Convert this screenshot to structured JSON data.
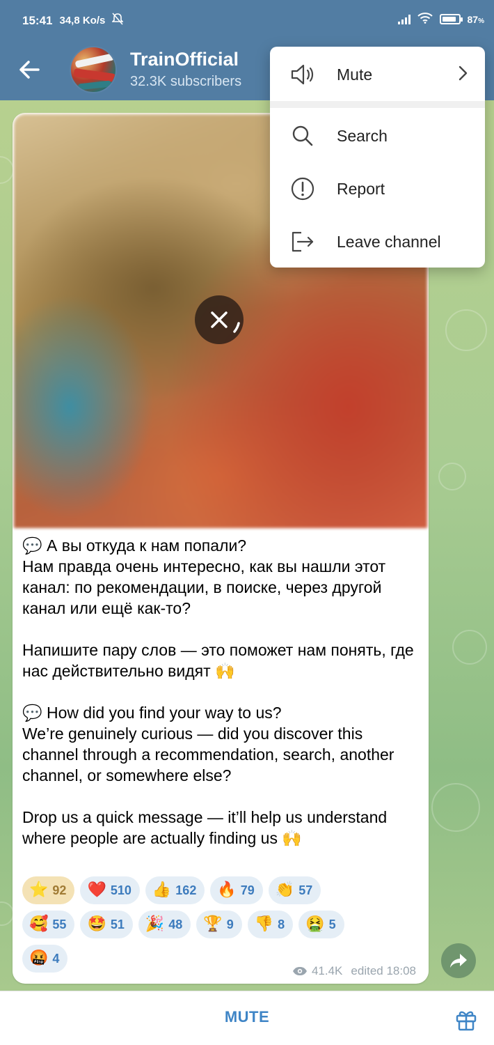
{
  "status_bar": {
    "time": "15:41",
    "speed": "34,8 Ko/s",
    "battery": "87",
    "battery_suffix": "%",
    "battery_level": 0.87
  },
  "header": {
    "channel_name": "TrainOfficial",
    "subscribers": "32.3K subscribers",
    "icons": {
      "back": "arrow-left-icon",
      "avatar": "channel-avatar"
    }
  },
  "menu": {
    "items": [
      {
        "label": "Mute",
        "icon": "speaker-icon",
        "has_submenu": true
      },
      {
        "label": "Search",
        "icon": "search-icon"
      },
      {
        "label": "Report",
        "icon": "report-icon"
      },
      {
        "label": "Leave channel",
        "icon": "leave-icon"
      }
    ]
  },
  "message": {
    "text": "💬 А вы откуда к нам попали?\nНам правда очень интересно, как вы нашли этот канал: по рекомендации, в поиске, через другой канал или ещё как-то?\n\nНапишите пару слов — это поможет нам понять, где нас действительно видят 🙌\n\n💬 How did you find your way to us?\nWe’re genuinely curious — did you discover this channel through a recommendation, search, another channel, or somewhere else?\n\nDrop us a quick message — it’ll help us understand where people are actually finding us 🙌",
    "views": "41.4K",
    "edited": "edited 18:08",
    "reactions": [
      {
        "emoji": "⭐",
        "count": "92",
        "active": true
      },
      {
        "emoji": "❤️",
        "count": "510"
      },
      {
        "emoji": "👍",
        "count": "162"
      },
      {
        "emoji": "🔥",
        "count": "79"
      },
      {
        "emoji": "👏",
        "count": "57"
      },
      {
        "emoji": "🥰",
        "count": "55"
      },
      {
        "emoji": "🤩",
        "count": "51"
      },
      {
        "emoji": "🎉",
        "count": "48"
      },
      {
        "emoji": "🏆",
        "count": "9"
      },
      {
        "emoji": "👎",
        "count": "8"
      },
      {
        "emoji": "🤮",
        "count": "5"
      },
      {
        "emoji": "🤬",
        "count": "4"
      }
    ]
  },
  "bottom_bar": {
    "mute_label": "MUTE",
    "gift_icon": "gift-icon"
  },
  "colors": {
    "header_bg": "#527da3",
    "accent": "#3f85c6",
    "reaction_bg": "#e5eef6",
    "reaction_active_bg": "#f4e2b5"
  }
}
